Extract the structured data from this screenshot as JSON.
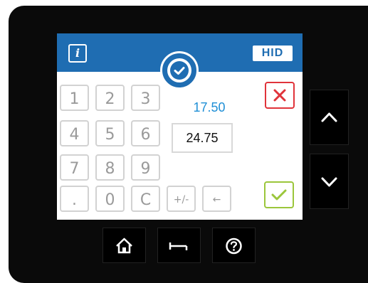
{
  "header": {
    "info_label": "i",
    "brand_label": "HID"
  },
  "keypad": {
    "rows": [
      [
        "1",
        "2",
        "3"
      ],
      [
        "4",
        "5",
        "6"
      ],
      [
        "7",
        "8",
        "9"
      ],
      [
        ".",
        "0",
        "C"
      ]
    ],
    "extra_keys": [
      "+/-",
      "←"
    ]
  },
  "values": {
    "reference": "17.50",
    "entry": "24.75"
  },
  "icons": {
    "confirm_badge": "check-circle-icon",
    "cancel": "close-icon",
    "ok": "check-icon",
    "scroll_up": "chevron-up-icon",
    "scroll_down": "chevron-down-icon",
    "home": "home-icon",
    "back": "back-arrow-icon",
    "help": "help-icon"
  },
  "colors": {
    "header_bg": "#1f6db2",
    "reference_value": "#1f8fd6",
    "cancel": "#e0333a",
    "ok": "#9bc63b"
  }
}
